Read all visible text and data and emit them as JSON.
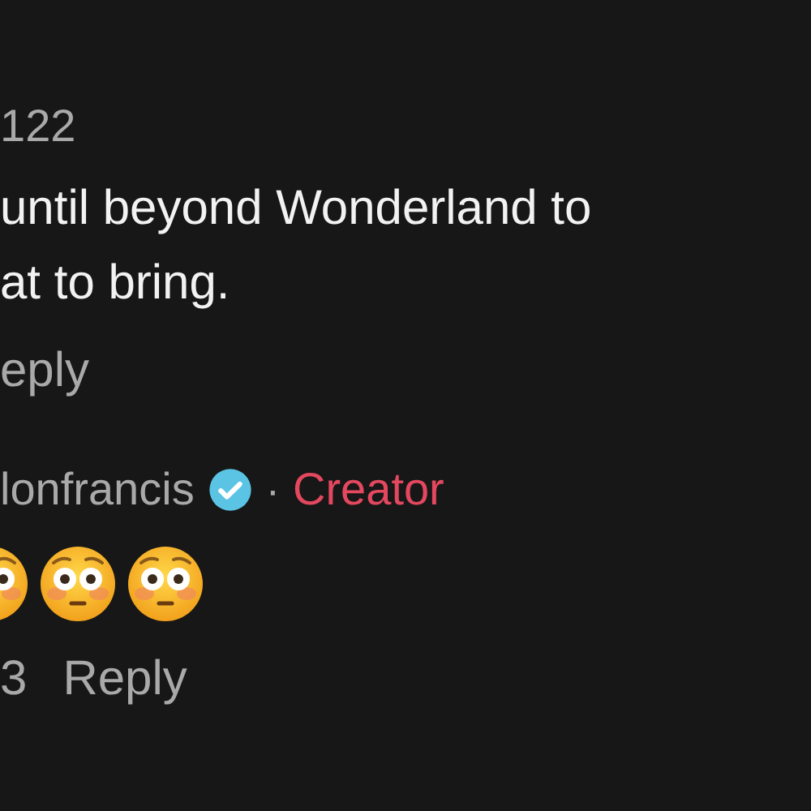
{
  "comment": {
    "date": "122",
    "text_lines": [
      "until beyond Wonderland to",
      "at to bring."
    ],
    "reply_label": "eply"
  },
  "reply": {
    "author": "lonfrancis",
    "verified": true,
    "separator": "·",
    "role_label": "Creator",
    "content": [
      {
        "kind": "flushed-face"
      },
      {
        "kind": "flushed-face"
      },
      {
        "kind": "flushed-face"
      }
    ],
    "likes": "3",
    "reply_label": "Reply"
  }
}
